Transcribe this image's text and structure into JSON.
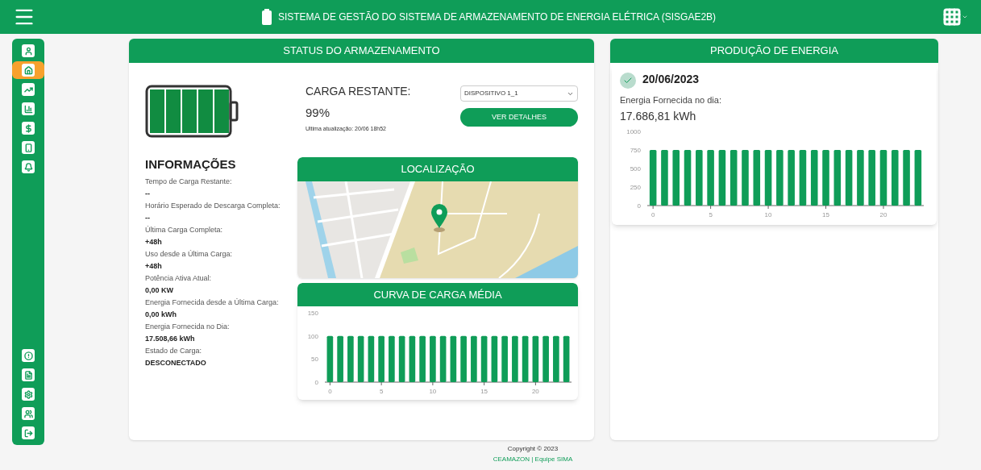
{
  "header": {
    "title": "SISTEMA DE GESTÃO DO SISTEMA DE ARMAZENAMENTO DE ENERGIA ELÉTRICA (SISGAE2B)"
  },
  "sidebar": {
    "top_items": [
      {
        "selected": false
      },
      {
        "selected": true
      },
      {
        "selected": false
      },
      {
        "selected": false
      },
      {
        "selected": false
      },
      {
        "selected": false
      },
      {
        "selected": false
      }
    ],
    "bottom_items": [
      {
        "selected": false
      },
      {
        "selected": false
      },
      {
        "selected": false
      },
      {
        "selected": false
      },
      {
        "selected": false
      }
    ]
  },
  "storage": {
    "title": "STATUS DO ARMAZENAMENTO",
    "charge_label": "CARGA RESTANTE:",
    "charge_value": "99%",
    "last_update": "Ultima atualização: 20/06 18h52",
    "device": "DISPOSITIVO 1_1",
    "details_button": "VER DETALHES",
    "info_title": "INFORMAÇÕES",
    "info": [
      {
        "label": "Tempo de Carga Restante:",
        "value": "--"
      },
      {
        "label": "Horário Esperado de Descarga Completa:",
        "value": "--"
      },
      {
        "label": "Última Carga Completa:",
        "value": "+48h"
      },
      {
        "label": "Uso desde a Última Carga:",
        "value": "+48h"
      },
      {
        "label": "Potência Ativa Atual:",
        "value": "0,00 KW"
      },
      {
        "label": "Energia Fornecida desde a Última Carga:",
        "value": "0,00 kWh"
      },
      {
        "label": "Energia Fornecida no Dia:",
        "value": "17.508,66 kWh"
      },
      {
        "label": "Estado de Carga:",
        "value": "DESCONECTADO"
      }
    ],
    "location": {
      "title": "LOCALIZAÇÃO",
      "kind": "picture"
    },
    "load_curve": {
      "title": "CURVA DE CARGA MÉDIA",
      "chart_data": {
        "type": "bar",
        "x": [
          0,
          1,
          2,
          3,
          4,
          5,
          6,
          7,
          8,
          9,
          10,
          11,
          12,
          13,
          14,
          15,
          16,
          17,
          18,
          19,
          20,
          21,
          22,
          23
        ],
        "series": [
          {
            "color": "#0f9d58",
            "values": [
              100,
              100,
              100,
              100,
              100,
              100,
              100,
              100,
              100,
              100,
              100,
              100,
              100,
              100,
              100,
              100,
              100,
              100,
              100,
              100,
              100,
              100,
              100,
              100
            ]
          }
        ],
        "xlim": [
          -0.5,
          23.5
        ],
        "ylim": [
          0,
          150
        ],
        "yticks": [
          0,
          50,
          100,
          150
        ],
        "xticks": [
          0,
          5,
          10,
          15,
          20
        ]
      }
    }
  },
  "production": {
    "title": "PRODUÇÃO DE ENERGIA",
    "date": "20/06/2023",
    "label": "Energia Fornecida no dia:",
    "value": "17.686,81 kWh",
    "chart_data": {
      "type": "bar",
      "x": [
        0,
        1,
        2,
        3,
        4,
        5,
        6,
        7,
        8,
        9,
        10,
        11,
        12,
        13,
        14,
        15,
        16,
        17,
        18,
        19,
        20,
        21,
        22,
        23
      ],
      "series": [
        {
          "color": "#0f9d58",
          "values": [
            750,
            750,
            750,
            750,
            750,
            750,
            750,
            750,
            750,
            750,
            750,
            750,
            750,
            750,
            750,
            750,
            750,
            750,
            750,
            750,
            750,
            750,
            750,
            750
          ]
        }
      ],
      "xlim": [
        -0.5,
        23.5
      ],
      "ylim": [
        0,
        1000
      ],
      "yticks": [
        0,
        250,
        500,
        750,
        1000
      ],
      "xticks": [
        0,
        5,
        10,
        15,
        20
      ]
    }
  },
  "footer": {
    "copyright": "Copyright © 2023",
    "credits": "CEAMAZON | Equipe SIMA"
  }
}
